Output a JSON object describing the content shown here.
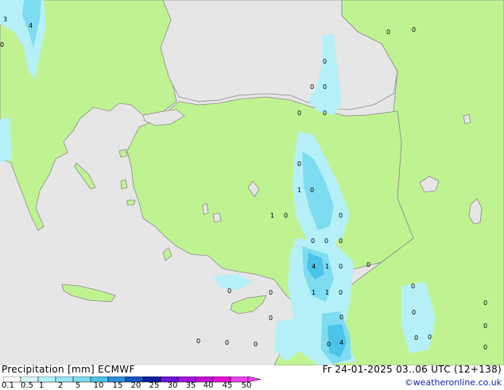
{
  "map": {
    "colors": {
      "sea": "#e6e6e6",
      "land": "#bff391",
      "coast": "#8a8a8a",
      "precip_light": "#b5f0f8",
      "precip_mid": "#7edcf0",
      "precip_heavy": "#4cc3e8"
    },
    "labels": [
      {
        "id": "l1",
        "text": "3"
      },
      {
        "id": "l2",
        "text": "4"
      },
      {
        "id": "l3",
        "text": "0"
      },
      {
        "id": "l4",
        "text": "0"
      },
      {
        "id": "l5",
        "text": "0"
      },
      {
        "id": "l6",
        "text": "0"
      },
      {
        "id": "l7",
        "text": "0"
      },
      {
        "id": "l8",
        "text": "0"
      },
      {
        "id": "l9",
        "text": "0"
      },
      {
        "id": "l10",
        "text": "0"
      },
      {
        "id": "l11",
        "text": "0"
      },
      {
        "id": "l12",
        "text": "1"
      },
      {
        "id": "l13",
        "text": "0"
      },
      {
        "id": "l14",
        "text": "1"
      },
      {
        "id": "l15",
        "text": "0"
      },
      {
        "id": "l16",
        "text": "0"
      },
      {
        "id": "l17",
        "text": "0"
      },
      {
        "id": "l18",
        "text": "0"
      },
      {
        "id": "l19",
        "text": "0"
      },
      {
        "id": "l20",
        "text": "4"
      },
      {
        "id": "l21",
        "text": "1"
      },
      {
        "id": "l22",
        "text": "0"
      },
      {
        "id": "l23",
        "text": "0"
      },
      {
        "id": "l24",
        "text": "1"
      },
      {
        "id": "l25",
        "text": "1"
      },
      {
        "id": "l26",
        "text": "0"
      },
      {
        "id": "l27",
        "text": "0"
      },
      {
        "id": "l28",
        "text": "0"
      },
      {
        "id": "l29",
        "text": "0"
      },
      {
        "id": "l30",
        "text": "0"
      },
      {
        "id": "l31",
        "text": "0"
      },
      {
        "id": "l32",
        "text": "0"
      },
      {
        "id": "l33",
        "text": "0"
      },
      {
        "id": "l34",
        "text": "0"
      },
      {
        "id": "l35",
        "text": "0"
      },
      {
        "id": "l36",
        "text": "0"
      },
      {
        "id": "l37",
        "text": "0"
      },
      {
        "id": "l38",
        "text": "4"
      },
      {
        "id": "l39",
        "text": "0"
      },
      {
        "id": "l40",
        "text": "0"
      },
      {
        "id": "l41",
        "text": "0"
      },
      {
        "id": "l42",
        "text": "0"
      }
    ]
  },
  "footer": {
    "title": "Precipitation [mm] ECMWF",
    "valid_time": "Fr 24-01-2025 03..06 UTC (12+138)",
    "credit": "©weatheronline.co.uk"
  },
  "legend": {
    "ticks": [
      "0.1",
      "0.5",
      "1",
      "2",
      "5",
      "10",
      "15",
      "20",
      "25",
      "30",
      "35",
      "40",
      "45",
      "50"
    ],
    "colors": [
      "#ffffff",
      "#d8f7fb",
      "#b5f0f8",
      "#95e6f5",
      "#7edcf0",
      "#4cc3e8",
      "#2a8fd8",
      "#1a55c0",
      "#0a1e9a",
      "#6a16d8",
      "#a414e0",
      "#c210d0",
      "#e410d8",
      "#f040f0"
    ]
  }
}
